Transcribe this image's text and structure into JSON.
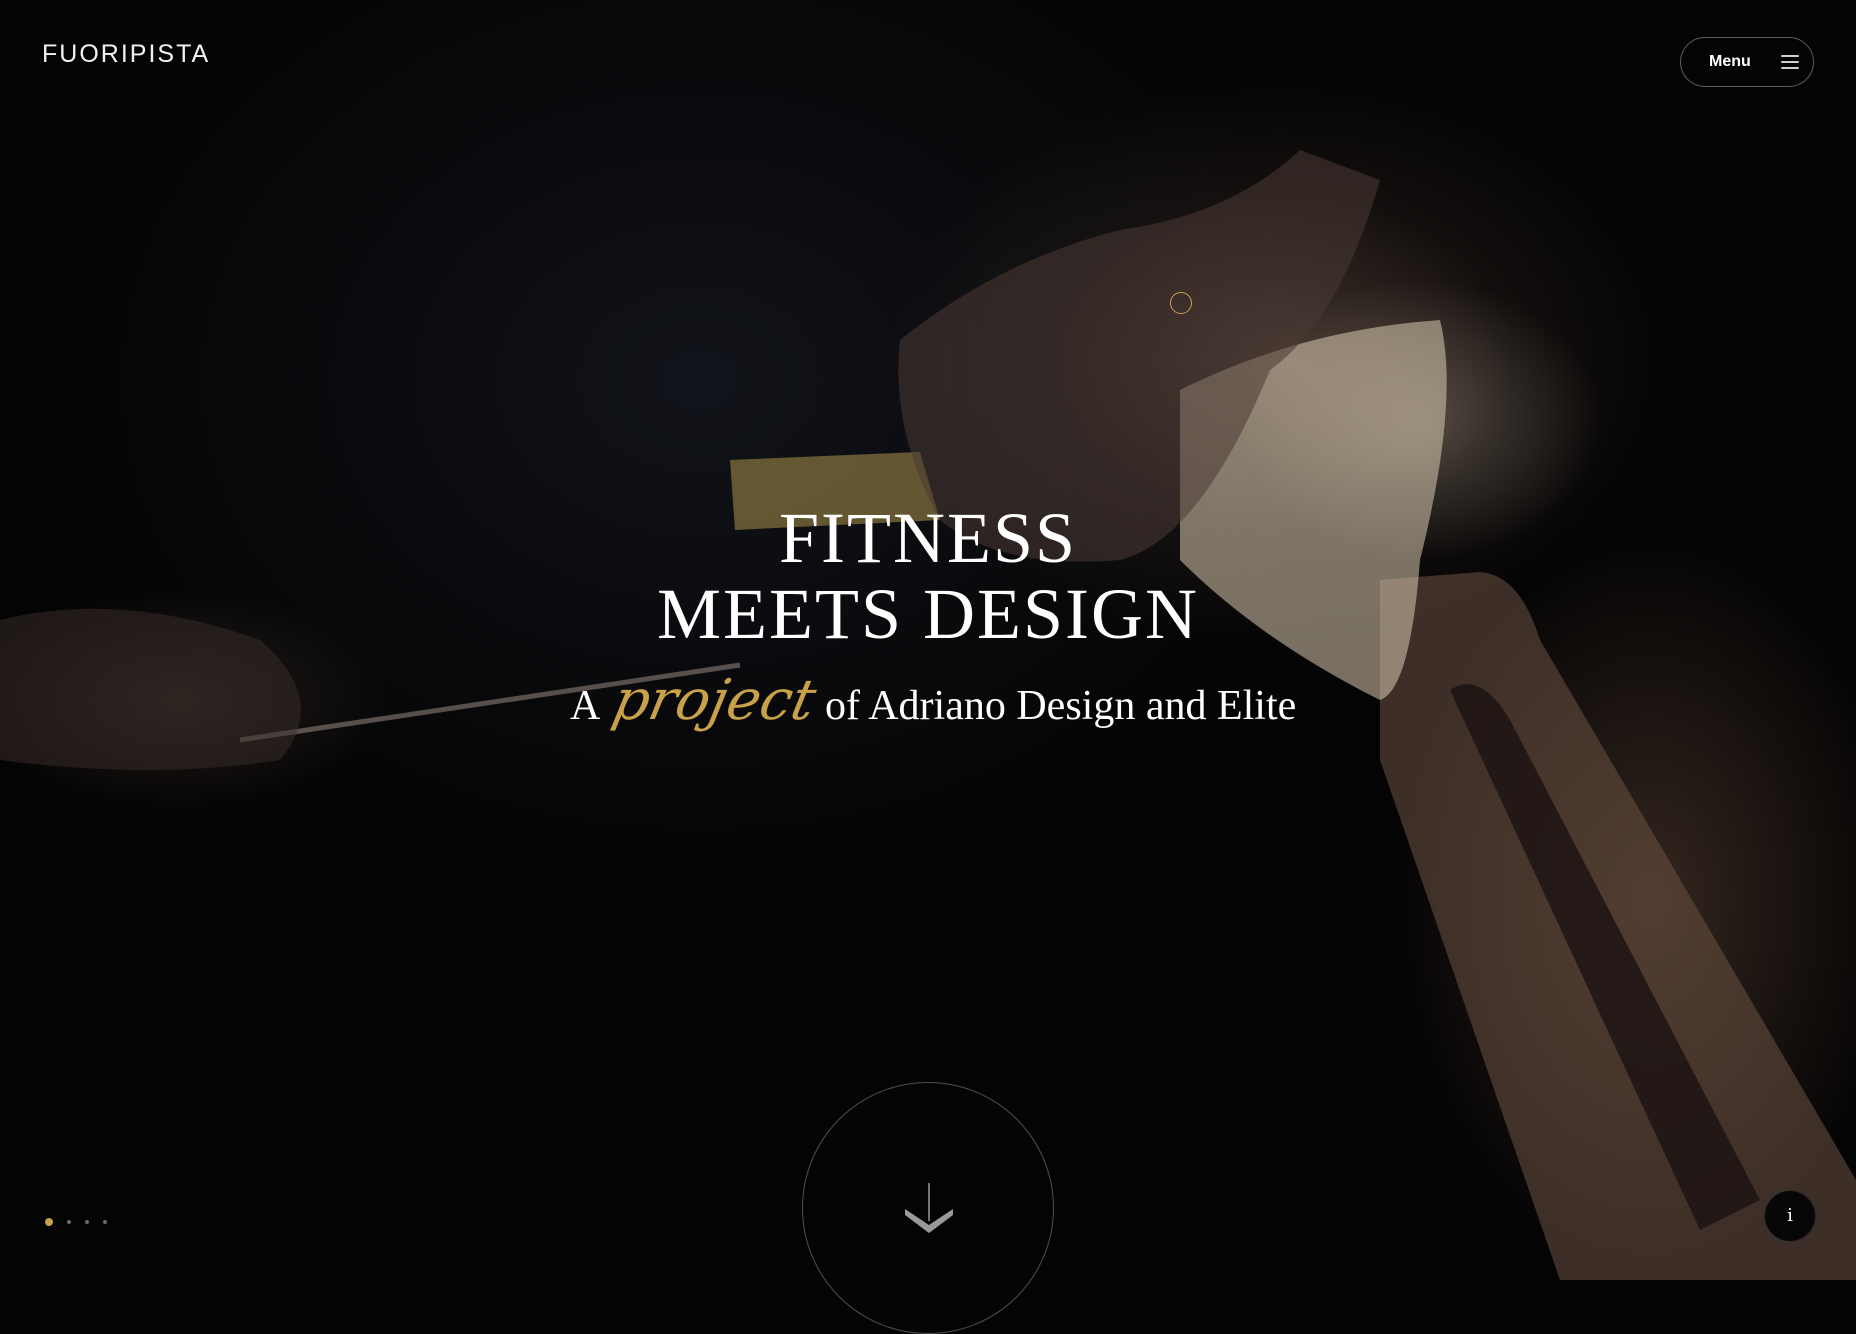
{
  "header": {
    "logo_text": "FUORIPISTA",
    "menu_label": "Menu"
  },
  "hero": {
    "headline_line1": "FITNESS",
    "headline_line2": "MEETS DESIGN",
    "tagline_prefix": "A",
    "tagline_script": "project",
    "tagline_suffix": "of Adriano Design and Elite"
  },
  "slider": {
    "total_slides": 4,
    "active_index": 0
  },
  "info_button": {
    "label": "i"
  },
  "colors": {
    "accent_gold": "#c9a14a",
    "text": "#ffffff",
    "background": "#050405"
  }
}
